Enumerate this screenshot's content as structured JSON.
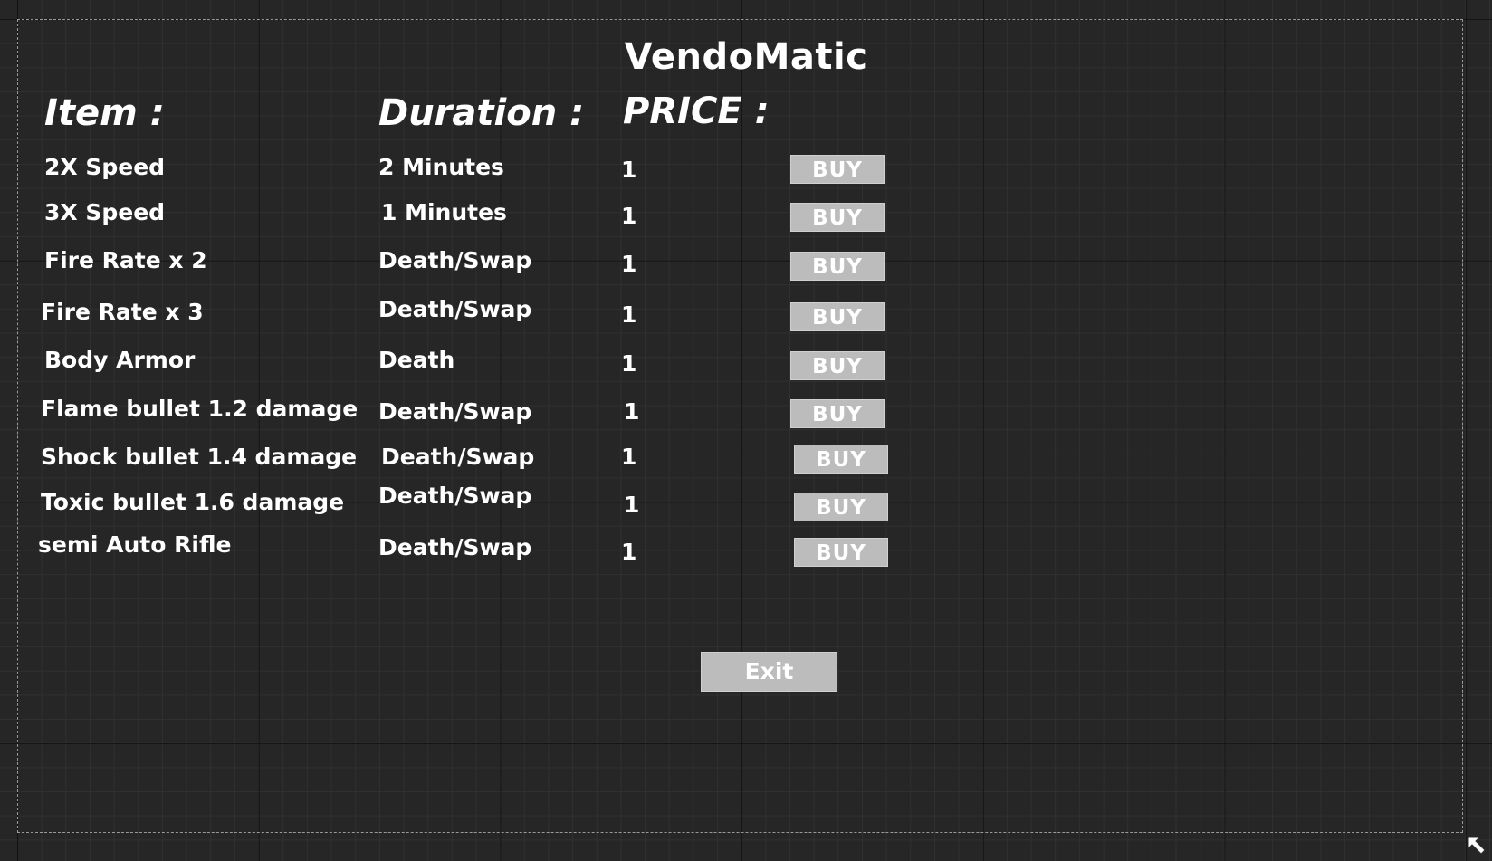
{
  "title": "VendoMatic",
  "headers": {
    "item": "Item :",
    "duration": "Duration :",
    "price": "PRICE :"
  },
  "rows": [
    {
      "item": "2X Speed",
      "duration": "2 Minutes",
      "price": "1",
      "buy": "BUY"
    },
    {
      "item": "3X Speed",
      "duration": "1 Minutes",
      "price": "1",
      "buy": "BUY"
    },
    {
      "item": "Fire Rate x 2",
      "duration": "Death/Swap",
      "price": "1",
      "buy": "BUY"
    },
    {
      "item": "Fire Rate x 3",
      "duration": "Death/Swap",
      "price": "1",
      "buy": "BUY"
    },
    {
      "item": "Body Armor",
      "duration": "Death",
      "price": "1",
      "buy": "BUY"
    },
    {
      "item": "Flame bullet 1.2 damage",
      "duration": "Death/Swap",
      "price": "1",
      "buy": "BUY"
    },
    {
      "item": "Shock bullet 1.4 damage",
      "duration": "Death/Swap",
      "price": "1",
      "buy": "BUY"
    },
    {
      "item": "Toxic bullet 1.6 damage",
      "duration": "Death/Swap",
      "price": "1",
      "buy": "BUY"
    },
    {
      "item": "semi Auto Rifle",
      "duration": "Death/Swap",
      "price": "1",
      "buy": "BUY"
    }
  ],
  "exit_label": "Exit",
  "colors": {
    "background": "#262626",
    "button": "#bcbcbc",
    "text": "#ffffff"
  },
  "icons": {
    "resize": "resize-handle-icon"
  }
}
